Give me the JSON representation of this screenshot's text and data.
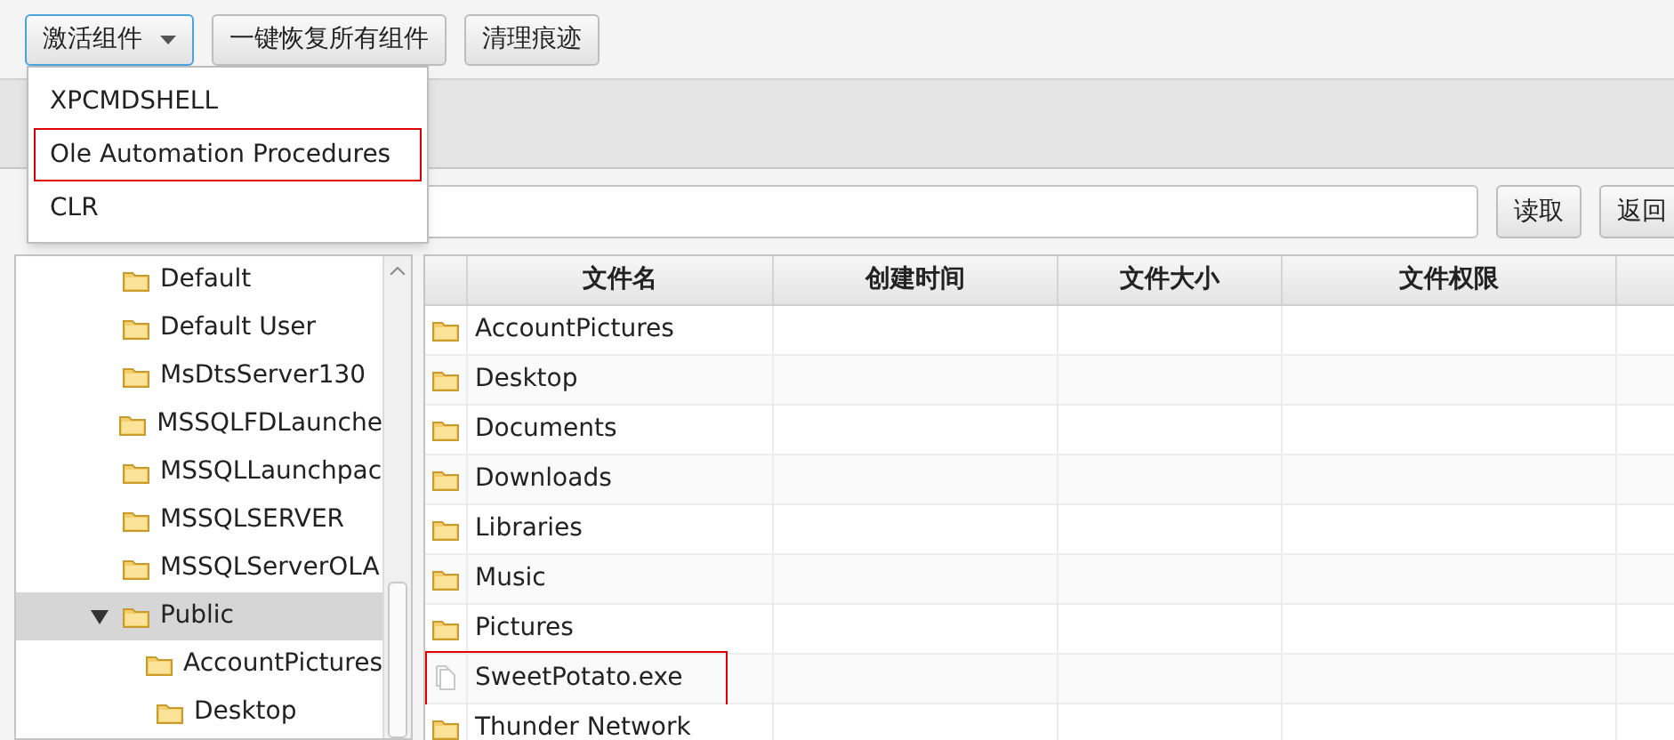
{
  "toolbar": {
    "buttons": [
      {
        "label": "激活组件",
        "kind": "dropdown",
        "focused": true
      },
      {
        "label": "一键恢复所有组件",
        "kind": "plain",
        "focused": false
      },
      {
        "label": "清理痕迹",
        "kind": "plain",
        "focused": false
      }
    ]
  },
  "dropdown_menu": {
    "items": [
      {
        "label": "XPCMDSHELL",
        "highlighted": false
      },
      {
        "label": "Ole Automation Procedures",
        "highlighted": true
      },
      {
        "label": "CLR",
        "highlighted": false
      }
    ]
  },
  "path_bar": {
    "buttons": [
      "读取",
      "返回"
    ]
  },
  "tree": {
    "items": [
      {
        "label": "Default",
        "selected": false
      },
      {
        "label": "Default User",
        "selected": false
      },
      {
        "label": "MsDtsServer130",
        "selected": false
      },
      {
        "label": "MSSQLFDLaunche",
        "selected": false
      },
      {
        "label": "MSSQLLaunchpac",
        "selected": false
      },
      {
        "label": "MSSQLSERVER",
        "selected": false
      },
      {
        "label": "MSSQLServerOLA",
        "selected": false
      },
      {
        "label": "Public",
        "expanded": true,
        "selected": true,
        "children": [
          {
            "label": "AccountPictures",
            "selected": false
          },
          {
            "label": "Desktop",
            "selected": false
          }
        ]
      }
    ]
  },
  "table": {
    "columns": [
      "文件名",
      "创建时间",
      "文件大小",
      "文件权限"
    ],
    "rows": [
      {
        "name": "AccountPictures",
        "kind": "folder",
        "highlighted": false
      },
      {
        "name": "Desktop",
        "kind": "folder",
        "highlighted": false
      },
      {
        "name": "Documents",
        "kind": "folder",
        "highlighted": false
      },
      {
        "name": "Downloads",
        "kind": "folder",
        "highlighted": false
      },
      {
        "name": "Libraries",
        "kind": "folder",
        "highlighted": false
      },
      {
        "name": "Music",
        "kind": "folder",
        "highlighted": false
      },
      {
        "name": "Pictures",
        "kind": "folder",
        "highlighted": false
      },
      {
        "name": "SweetPotato.exe",
        "kind": "file",
        "highlighted": true
      },
      {
        "name": "Thunder Network",
        "kind": "folder",
        "highlighted": false
      }
    ]
  }
}
